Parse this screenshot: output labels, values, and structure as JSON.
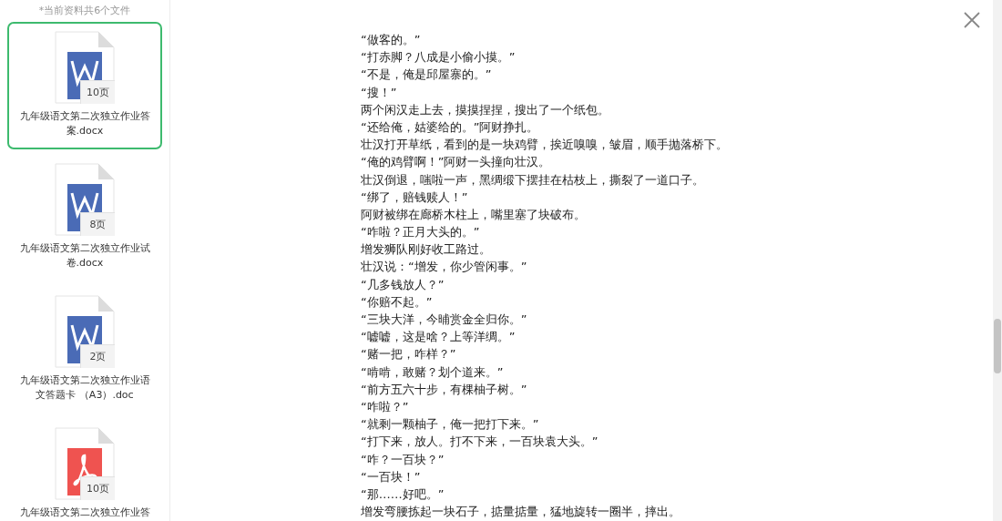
{
  "sidebar": {
    "header": "*当前资料共6个文件",
    "files": [
      {
        "kind": "word",
        "pages": "10页",
        "name": "九年级语文第二次独立作业答案.docx",
        "selected": true
      },
      {
        "kind": "word",
        "pages": "8页",
        "name": "九年级语文第二次独立作业试卷.docx",
        "selected": false
      },
      {
        "kind": "word",
        "pages": "2页",
        "name": "九年级语文第二次独立作业语文答题卡 （A3）.doc",
        "selected": false
      },
      {
        "kind": "pdf",
        "pages": "10页",
        "name": "九年级语文第二次独立作业答",
        "selected": false
      }
    ]
  },
  "document": {
    "lines": [
      "“做客的。”",
      "“打赤脚？八成是小偷小摸。”",
      "“不是，俺是邱屋寨的。”",
      "“搜！”",
      "两个闲汉走上去，摸摸捏捏，搜出了一个纸包。",
      "“还给俺，姑婆给的。”阿财挣扎。",
      "壮汉打开草纸，看到的是一块鸡臂，挨近嗅嗅，皱眉，顺手抛落桥下。",
      "“俺的鸡臂啊！”阿财一头撞向壮汉。",
      "壮汉倒退，嗤啦一声，黑绸缎下摆挂在枯枝上，撕裂了一道口子。",
      "“绑了，赔钱赎人！”",
      "阿财被绑在廊桥木柱上，嘴里塞了块破布。",
      "“咋啦？正月大头的。”",
      "增发狮队刚好收工路过。",
      "壮汉说：“增发，你少管闲事。”",
      "“几多钱放人？”",
      "“你赔不起。”",
      "“三块大洋，今晡赏金全归你。”",
      "“嘘嘘，这是啥？上等洋绸。”",
      "“赌一把，咋样？”",
      "“啃啃，敢赌？划个道来。”",
      "“前方五六十步，有棵柚子树。”",
      "“咋啦？”",
      "“就剩一颗柚子，俺一把打下来。”",
      "“打下来，放人。打不下来，一百块袁大头。”",
      "“咋？一百块？”",
      "“一百块！”",
      "“那……好吧。”",
      "增发弯腰拣起一块石子，掂量掂量，猛地旋转一圈半，摔出。"
    ]
  }
}
